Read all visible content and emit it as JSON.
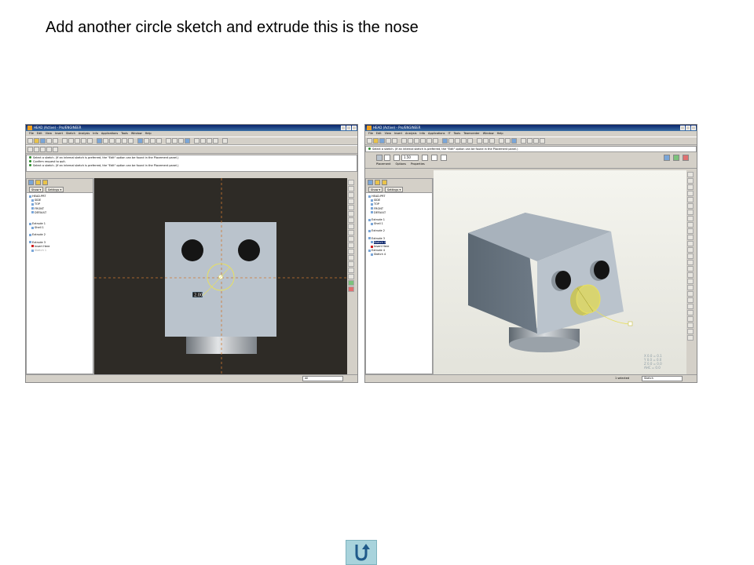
{
  "slide": {
    "title": "Add another circle sketch and extrude this is the nose"
  },
  "window": {
    "title": "HEAD (Active) - Pro/ENGINEER",
    "menu": [
      "File",
      "Edit",
      "View",
      "Insert",
      "Sketch",
      "Analysis",
      "Info",
      "Applications",
      "Tools",
      "Window",
      "Help"
    ]
  },
  "window_right": {
    "menu": [
      "File",
      "Edit",
      "View",
      "Insert",
      "Analysis",
      "Info",
      "Applications",
      "IT",
      "Tools",
      "Teamcenter",
      "Window",
      "Help"
    ]
  },
  "left_screen": {
    "messages": [
      "Select a sketch. (If an internal sketch is preferred, the \"Edit\" option can be found in the Placement panel.)",
      "Confirm request to quit.",
      "Select a sketch. (If an internal sketch is preferred, the \"Edit\" option can be found in the Placement panel.)"
    ],
    "tree_buttons": {
      "show": "Show ▾",
      "settings": "Settings ▾"
    },
    "tree": [
      "HEAD.PRT",
      "SIDE",
      "TOP",
      "FRONT",
      "DEFAULT",
      "",
      "Extrude 1",
      "Shell 1",
      "Extrude 2",
      "Extrude 3",
      "Insert Here",
      "Sketch 1"
    ],
    "dimension": "2.00",
    "status_filter": "All"
  },
  "right_screen": {
    "messages": [
      "Select a sketch. (If an internal sketch is preferred, the \"Edit\" option can be found in the Placement panel.)"
    ],
    "dashboard_tabs": [
      "Placement",
      "Options",
      "Properties"
    ],
    "depth_value": "1.50",
    "tree_buttons": {
      "show": "Show ▾",
      "settings": "Settings ▾"
    },
    "tree": [
      "HEAD.PRT",
      "SIDE",
      "TOP",
      "FRONT",
      "DEFAULT",
      "Extrude 1",
      "Shell 1",
      "Extrude 2",
      "Extrude 3",
      "Sketch 2",
      "Insert Here",
      "Extrude 4",
      "Sketch 4"
    ],
    "selected_count": "1 selected",
    "status_filter": "Sketch",
    "coords": [
      "X 0.0 = 0.1",
      "Y 0.0 = 0.0",
      "Z 0.0 = 0.0",
      "AHC = 0.0"
    ]
  },
  "colors": {
    "face_light": "#bac3cc",
    "face_dark": "#6f7c88",
    "sketch_background": "#2e2b26",
    "highlight": "#e8e060",
    "back_button": "#a8d3dc"
  },
  "icons": {
    "back": "u-turn-arrow-icon"
  }
}
